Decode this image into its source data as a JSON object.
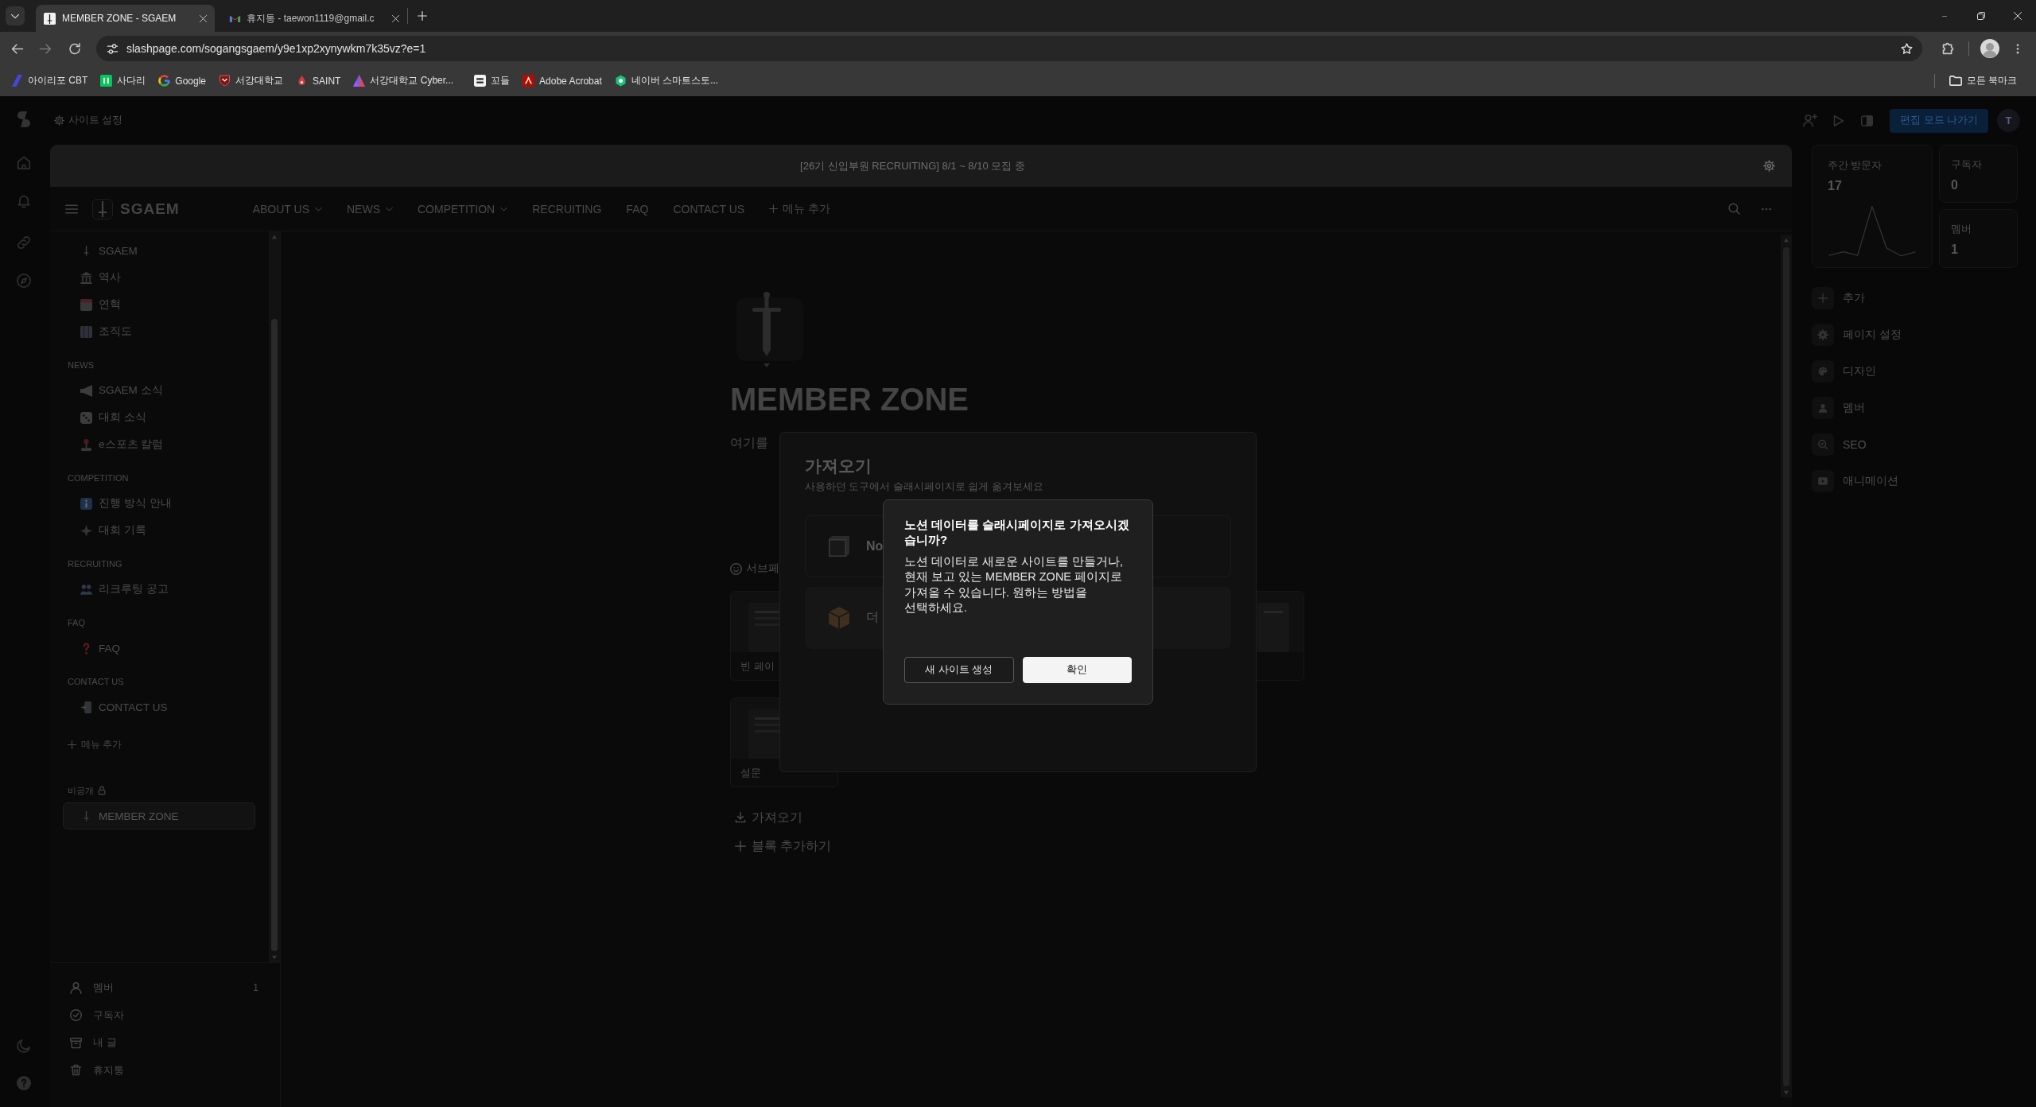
{
  "browser": {
    "tabs": [
      {
        "title": "MEMBER ZONE - SGAEM",
        "selected": true
      },
      {
        "title": "휴지통 - taewon1119@gmail.c",
        "selected": false
      }
    ],
    "address": "slashpage.com/sogangsgaem/y9e1xp2xynywkm7k35vz?e=1",
    "bookmarks": [
      "아이리포 CBT",
      "사다리",
      "Google",
      "서강대학교",
      "SAINT",
      "서강대학교 Cyber...",
      "꼬들",
      "Adobe Acrobat",
      "네이버 스마트스토..."
    ],
    "all_bookmarks": "모든 북마크"
  },
  "topbar": {
    "site_settings": "사이트 설정",
    "exit_edit_button": "편집 모드 나가기",
    "avatar": "T"
  },
  "banner": "[26기 신입부원 RECRUITING] 8/1 ~ 8/10 모집 중",
  "navbar": {
    "logo": "SGAEM",
    "items": [
      {
        "label": "ABOUT US",
        "dropdown": true
      },
      {
        "label": "NEWS",
        "dropdown": true
      },
      {
        "label": "COMPETITION",
        "dropdown": true
      },
      {
        "label": "RECRUITING",
        "dropdown": false
      },
      {
        "label": "FAQ",
        "dropdown": false
      },
      {
        "label": "CONTACT US",
        "dropdown": false
      }
    ],
    "add_menu": "메뉴 추가"
  },
  "sidebar": {
    "sections": [
      {
        "items": [
          {
            "label": "SGAEM",
            "selected": false
          },
          {
            "label": "역사",
            "selected": false
          },
          {
            "label": "연혁",
            "selected": false
          },
          {
            "label": "조직도",
            "selected": false
          }
        ]
      },
      {
        "heading": "NEWS",
        "items": [
          {
            "label": "SGAEM 소식",
            "selected": false
          },
          {
            "label": "대회 소식",
            "selected": false
          },
          {
            "label": "e스포츠 칼럼",
            "selected": false
          }
        ]
      },
      {
        "heading": "COMPETITION",
        "items": [
          {
            "label": "진행 방식 안내",
            "selected": false
          },
          {
            "label": "대회 기록",
            "selected": false
          }
        ]
      },
      {
        "heading": "RECRUITING",
        "items": [
          {
            "label": "리크루팅 공고",
            "selected": false
          }
        ]
      },
      {
        "heading": "FAQ",
        "items": [
          {
            "label": "FAQ",
            "selected": false
          }
        ]
      },
      {
        "heading": "CONTACT US",
        "items": [
          {
            "label": "CONTACT US",
            "selected": false
          }
        ]
      }
    ],
    "add_menu": "메뉴 추가",
    "private": {
      "heading": "비공개",
      "items": [
        {
          "label": "MEMBER ZONE",
          "selected": true
        }
      ]
    },
    "footer": [
      {
        "label": "멤버",
        "count": "1"
      },
      {
        "label": "구독자"
      },
      {
        "label": "내 글"
      },
      {
        "label": "휴지통"
      }
    ]
  },
  "page": {
    "title": "MEMBER ZONE",
    "description": {
      "placeholder": "여기를"
    },
    "subpages_heading": "서브페",
    "templates": [
      "빈 페이",
      "설문"
    ],
    "import_link": "가져오기",
    "add_block": "블록 추가하기"
  },
  "import_modal": {
    "title": "가져오기",
    "subtitle": "사용하던 도구에서 슬래시페이지로 쉽게 옮겨보세요",
    "options": [
      "No",
      "더"
    ]
  },
  "confirm_dialog": {
    "title": "노션 데이터를 슬래시페이지로 가져오시겠습니까?",
    "body": "노션 데이터로 새로운 사이트를 만들거나, 현재 보고 있는 MEMBER ZONE 페이지로 가져올 수 있습니다. 원하는 방법을 선택하세요.",
    "buttons": [
      {
        "label": "새 사이트 생성",
        "kind": "secondary"
      },
      {
        "label": "확인",
        "kind": "primary"
      }
    ]
  },
  "right_panel": {
    "stats": [
      {
        "label": "주간 방문자",
        "value": "17",
        "kind": "trend"
      },
      {
        "label": "구독자",
        "value": "0",
        "kind": "plain"
      },
      {
        "label": "멤버",
        "value": "1",
        "kind": "plain"
      }
    ],
    "actions": [
      "추가",
      "페이지 설정",
      "디자인",
      "멤버",
      "SEO",
      "애니메이션"
    ]
  }
}
